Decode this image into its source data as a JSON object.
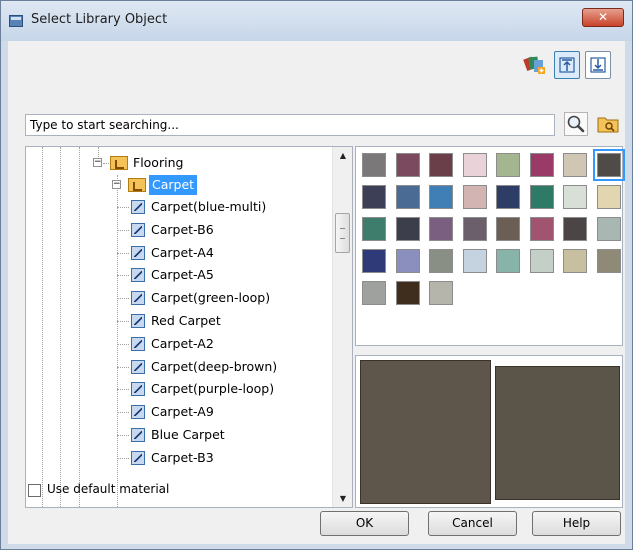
{
  "window": {
    "title": "Select Library Object",
    "close_glyph": "✕"
  },
  "toolbar": {
    "icons": [
      "tree-icon",
      "move-up-icon",
      "move-down-icon"
    ]
  },
  "search": {
    "placeholder": "Type to start searching..."
  },
  "tree": {
    "parent": {
      "label": "Flooring",
      "expanded": true
    },
    "folder": {
      "label": "Carpet",
      "expanded": true,
      "selected": true
    },
    "items": [
      "Carpet(blue-multi)",
      "Carpet-B6",
      "Carpet-A4",
      "Carpet-A5",
      "Carpet(green-loop)",
      "Red Carpet",
      "Carpet-A2",
      "Carpet(deep-brown)",
      "Carpet(purple-loop)",
      "Carpet-A9",
      "Blue Carpet",
      "Carpet-B3"
    ]
  },
  "swatches": {
    "selected_index": 7,
    "colors": [
      "#7a7878",
      "#7b4a5f",
      "#6b3f4a",
      "#e9d2d8",
      "#a4b68f",
      "#9a3a66",
      "#cfc6b4",
      "#4f4b46",
      "#3d3f57",
      "#4a6b93",
      "#3f7fb6",
      "#d2b4b2",
      "#2e3d66",
      "#2f7a66",
      "#d8dfd6",
      "#e2d6b1",
      "#3e7c6c",
      "#3d3e4c",
      "#7a5f80",
      "#6c5f6c",
      "#6b5f55",
      "#a0546f",
      "#4c4545",
      "#a9b7b2",
      "#2e3b78",
      "#8a8fbe",
      "#8a8f86",
      "#c5d3e1",
      "#87b3a9",
      "#c3cfc7",
      "#c7bf9f",
      "#8f8a78",
      "#9ea19d",
      "#3f2e1e",
      "#b6b5ac"
    ]
  },
  "preview": {
    "color_a": "#5e564b",
    "color_b": "#5b5448"
  },
  "options": {
    "use_default_material_label": "Use default material",
    "use_default_material_checked": false
  },
  "buttons": {
    "ok": "OK",
    "cancel": "Cancel",
    "help": "Help"
  }
}
